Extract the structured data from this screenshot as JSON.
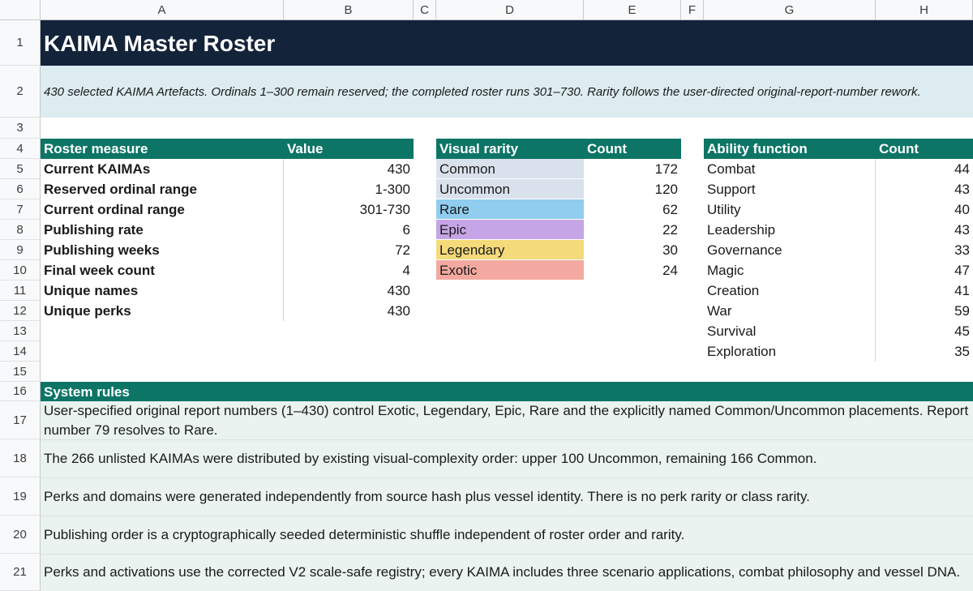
{
  "columns": [
    "A",
    "B",
    "C",
    "D",
    "E",
    "F",
    "G",
    "H"
  ],
  "rows": [
    "1",
    "2",
    "3",
    "4",
    "5",
    "6",
    "7",
    "8",
    "9",
    "10",
    "11",
    "12",
    "13",
    "14",
    "15",
    "16",
    "17",
    "18",
    "19",
    "20",
    "21"
  ],
  "title": "KAIMA Master Roster",
  "subtitle": "430 selected KAIMA Artefacts. Ordinals 1–300 remain reserved; the completed roster runs 301–730. Rarity follows the user-directed original-report-number rework.",
  "roster": {
    "header": [
      "Roster measure",
      "Value"
    ],
    "items": [
      {
        "label": "Current KAIMAs",
        "value": "430"
      },
      {
        "label": "Reserved ordinal range",
        "value": "1-300"
      },
      {
        "label": "Current ordinal range",
        "value": "301-730"
      },
      {
        "label": "Publishing rate",
        "value": "6"
      },
      {
        "label": "Publishing weeks",
        "value": "72"
      },
      {
        "label": "Final week count",
        "value": "4"
      },
      {
        "label": "Unique names",
        "value": "430"
      },
      {
        "label": "Unique perks",
        "value": "430"
      }
    ]
  },
  "rarity": {
    "header": [
      "Visual rarity",
      "Count"
    ],
    "items": [
      {
        "label": "Common",
        "count": "172",
        "color": "#d9e1ec"
      },
      {
        "label": "Uncommon",
        "count": "120",
        "color": "#d9e1ec"
      },
      {
        "label": "Rare",
        "count": "62",
        "color": "#90cdee"
      },
      {
        "label": "Epic",
        "count": "22",
        "color": "#c6a5e6"
      },
      {
        "label": "Legendary",
        "count": "30",
        "color": "#f5da7a"
      },
      {
        "label": "Exotic",
        "count": "24",
        "color": "#f4a9a0"
      }
    ]
  },
  "ability": {
    "header": [
      "Ability function",
      "Count"
    ],
    "items": [
      {
        "label": "Combat",
        "count": "44"
      },
      {
        "label": "Support",
        "count": "43"
      },
      {
        "label": "Utility",
        "count": "40"
      },
      {
        "label": "Leadership",
        "count": "43"
      },
      {
        "label": "Governance",
        "count": "33"
      },
      {
        "label": "Magic",
        "count": "47"
      },
      {
        "label": "Creation",
        "count": "41"
      },
      {
        "label": "War",
        "count": "59"
      },
      {
        "label": "Survival",
        "count": "45"
      },
      {
        "label": "Exploration",
        "count": "35"
      }
    ]
  },
  "rules": {
    "header": "System rules",
    "items": [
      "User-specified original report numbers (1–430) control Exotic, Legendary, Epic, Rare and the explicitly named Common/Uncommon placements. Report number 79 resolves to Rare.",
      "The 266 unlisted KAIMAs were distributed by existing visual-complexity order: upper 100 Uncommon, remaining 166 Common.",
      "Perks and domains were generated independently from source hash plus vessel identity. There is no perk rarity or class rarity.",
      "Publishing order is a cryptographically seeded deterministic shuffle independent of roster order and rarity.",
      "Perks and activations use the corrected V2 scale-safe registry; every KAIMA includes three scenario applications, combat philosophy and vessel DNA."
    ]
  }
}
